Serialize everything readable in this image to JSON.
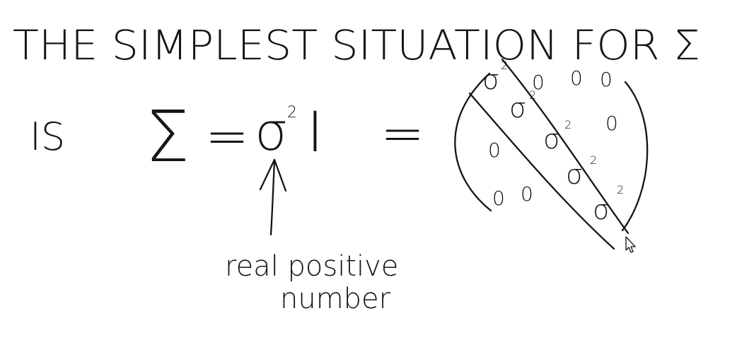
{
  "title": "THE SIMPLEST SITUATION FOR Σ",
  "statement_word": "IS",
  "equation": {
    "lhs": "Σ",
    "equals": "=",
    "coefficient": "σ",
    "coefficient_power": "2",
    "identity": "I",
    "equals_2": "="
  },
  "matrix": {
    "diagonal_entry": "σ",
    "diagonal_power": "2",
    "off_diagonal_entry": "0"
  },
  "annotation": {
    "line_1": "real positive",
    "line_2": "number"
  },
  "ink_color": "#151515",
  "icons": [
    "mouse-pointer-icon",
    "arrow-up-icon"
  ]
}
